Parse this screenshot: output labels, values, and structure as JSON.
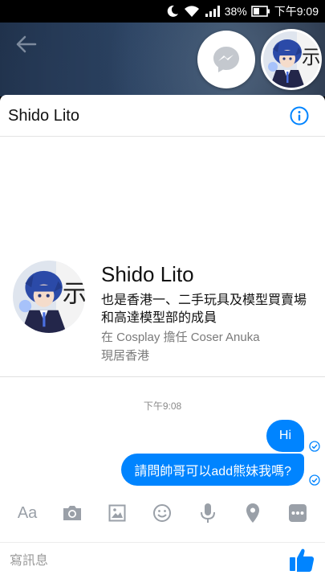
{
  "status_bar": {
    "battery": "38%",
    "time": "下午9:09",
    "icons": [
      "moon-icon",
      "wifi-icon",
      "signal-icon",
      "battery-icon"
    ]
  },
  "header": {
    "title": "Shido Lito"
  },
  "profile": {
    "name": "Shido Lito",
    "bio": "也是香港一、二手玩具及模型買賣場和高達模型部的成員",
    "work": "在 Cosplay 擔任 Coser Anuka",
    "location": "現居香港"
  },
  "conversation": {
    "timestamp": "下午9:08",
    "messages": [
      {
        "text": "Hi",
        "from": "me",
        "status": "sent"
      },
      {
        "text": "請問帥哥可以add熊妹我嗎?",
        "from": "me",
        "status": "sent"
      }
    ]
  },
  "toolbar": {
    "aa_label": "Aa",
    "icons": [
      "camera-icon",
      "gallery-icon",
      "emoji-icon",
      "microphone-icon",
      "location-icon",
      "more-icon"
    ]
  },
  "composer": {
    "placeholder": "寫訊息"
  },
  "colors": {
    "accent": "#0084ff",
    "icon_gray": "#9aa0a8"
  }
}
